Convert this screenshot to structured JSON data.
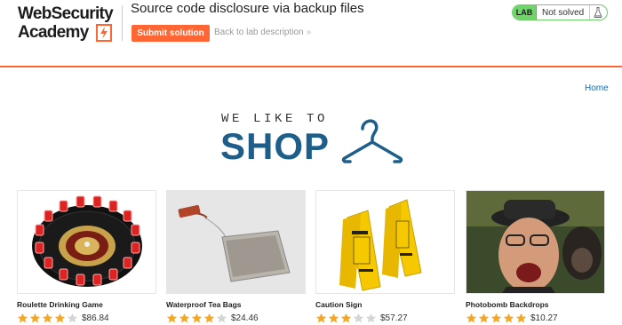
{
  "header": {
    "logo_line1": "WebSecurity",
    "logo_line2": "Academy",
    "lab_title": "Source code disclosure via backup files",
    "submit_label": "Submit solution",
    "back_label": "Back to lab description",
    "lab_badge": "LAB",
    "lab_status": "Not solved",
    "icons": [
      "bolt-icon",
      "chevron-right-icon",
      "flask-icon"
    ]
  },
  "colors": {
    "accent": "#ff6633",
    "link": "#0071bc",
    "brand_blue": "#1d5f8a",
    "status_green": "#70d46a",
    "star": "#f5a623",
    "star_empty": "#d5d5d5"
  },
  "nav": {
    "home_label": "Home"
  },
  "banner": {
    "tagline": "WE LIKE TO",
    "title": "SHOP",
    "icon": "hanger-icon"
  },
  "products": [
    {
      "name": "Roulette Drinking Game",
      "rating": 4,
      "price": "$86.84",
      "image": "roulette-image"
    },
    {
      "name": "Waterproof Tea Bags",
      "rating": 4,
      "price": "$24.46",
      "image": "tea-bag-image"
    },
    {
      "name": "Caution Sign",
      "rating": 3,
      "price": "$57.27",
      "image": "caution-sign-image"
    },
    {
      "name": "Photobomb Backdrops",
      "rating": 5,
      "price": "$10.27",
      "image": "photobomb-image"
    }
  ]
}
